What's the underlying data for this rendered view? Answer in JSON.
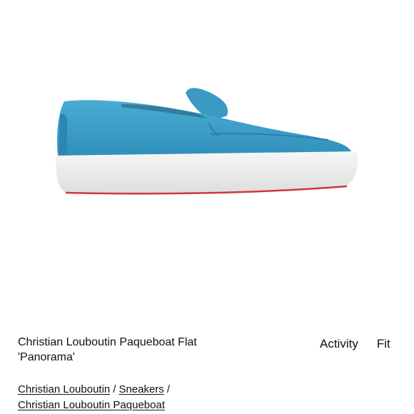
{
  "product": {
    "title": "Christian Louboutin Paqueboat Flat 'Panorama'",
    "image_icon": "shoe-product-image"
  },
  "tabs": [
    "Activity",
    "Fit"
  ],
  "breadcrumb": {
    "items": [
      "Christian Louboutin",
      "Sneakers",
      "Christian Louboutin Paqueboat"
    ],
    "separator": "/"
  },
  "colors": {
    "shoe_suede": "#3a9cc6",
    "sole": "#ececec",
    "sole_red_trim": "#d2363a"
  }
}
